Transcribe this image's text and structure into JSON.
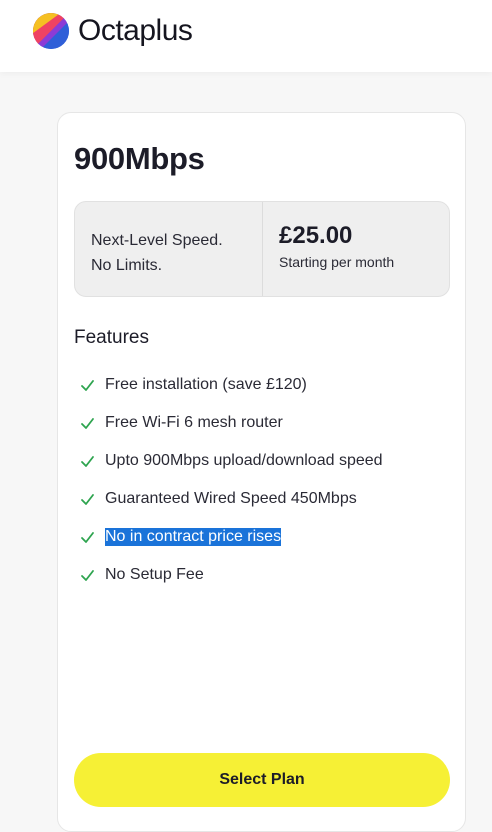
{
  "brand": {
    "name": "Octaplus",
    "logo_icon": "octaplus-logo-icon",
    "colors": [
      "#f5c022",
      "#ef4263",
      "#8c3bd6",
      "#2f5fd8"
    ]
  },
  "plan": {
    "title": "900Mbps",
    "tagline_line1": "Next-Level Speed.",
    "tagline_line2": "No Limits.",
    "price": "£25.00",
    "price_note": "Starting per month"
  },
  "features": {
    "heading": "Features",
    "check_icon": "check-icon",
    "check_color": "#2ea44f",
    "items": [
      "Free installation (save £120)",
      "Free Wi-Fi 6 mesh router",
      "Upto 900Mbps upload/download speed",
      "Guaranteed Wired Speed 450Mbps",
      "No in contract price rises",
      "No Setup Fee"
    ],
    "selected_item": "No in contract price rises"
  },
  "cta": {
    "label": "Select Plan",
    "color": "#f6f035"
  }
}
